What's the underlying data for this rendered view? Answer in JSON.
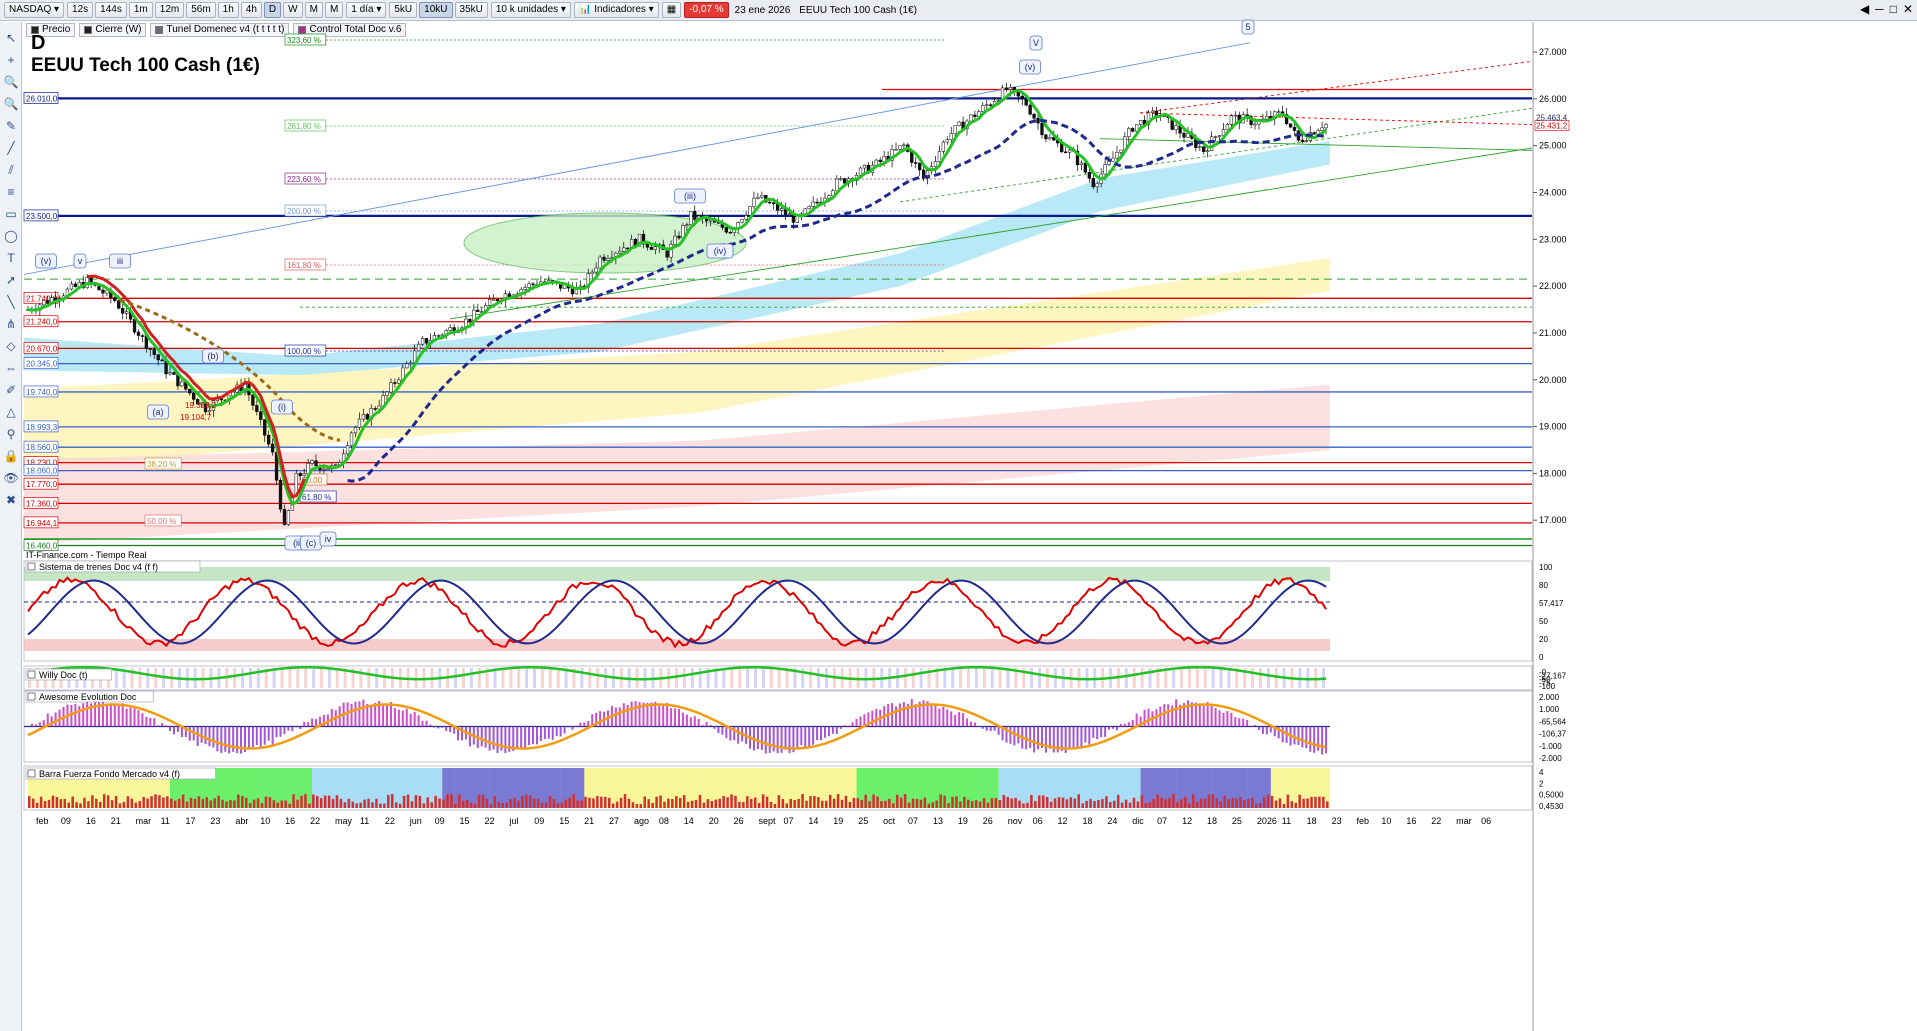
{
  "toolbar": {
    "symbol": "NASDAQ",
    "intervals": [
      "12s",
      "144s",
      "1m",
      "12m",
      "56m",
      "1h",
      "4h",
      "D",
      "W",
      "M",
      "M"
    ],
    "active_interval": "D",
    "period": "1 día",
    "units": [
      "5kU",
      "10kU",
      "35kU"
    ],
    "active_unit": "10kU",
    "unit_select": "10 k unidades",
    "indicators_label": "Indicadores",
    "change_badge": "-0,07 %",
    "date": "23 ene 2026",
    "instrument": "EEUU Tech 100 Cash (1€)"
  },
  "overlays": [
    "Precio",
    "Cierre (W)",
    "Tunel Domenec v4 (t t t t t)",
    "Control Total Doc v.6"
  ],
  "title": {
    "timeframe": "D",
    "name": "EEUU Tech 100 Cash (1€)"
  },
  "source": "IT-Finance.com - Tiempo Real",
  "price_axis": {
    "labels": [
      "27.000",
      "26.000",
      "25.000",
      "24.000",
      "23.000",
      "22.000",
      "21.000",
      "20.000",
      "19.000",
      "18.000",
      "17.000"
    ]
  },
  "price_current": [
    "25.431,2",
    "25.463,4"
  ],
  "level_labels": [
    {
      "text": "26.010,0",
      "color": "#0a1a8a"
    },
    {
      "text": "23.500,0",
      "color": "#0a1a8a"
    },
    {
      "text": "21.740,0",
      "color": "#d40000"
    },
    {
      "text": "21.240,0",
      "color": "#d40000"
    },
    {
      "text": "20.670,0",
      "color": "#d40000"
    },
    {
      "text": "20.345,0",
      "color": "#3a62c8"
    },
    {
      "text": "19.740,0",
      "color": "#3a62c8"
    },
    {
      "text": "18.993,3",
      "color": "#3a62c8"
    },
    {
      "text": "18.560,0",
      "color": "#3a62c8"
    },
    {
      "text": "18.230,0",
      "color": "#d40000"
    },
    {
      "text": "18.060,0",
      "color": "#3a62c8"
    },
    {
      "text": "17.770,0",
      "color": "#d40000"
    },
    {
      "text": "17.360,0",
      "color": "#d40000"
    },
    {
      "text": "16.944,1",
      "color": "#d40000"
    },
    {
      "text": "16.460,0",
      "color": "#1a7a1a"
    }
  ],
  "fib_labels": [
    {
      "text": "323,60 %",
      "color": "#1a8a1a"
    },
    {
      "text": "261,80 %",
      "color": "#5fbf5f"
    },
    {
      "text": "223,60 %",
      "color": "#8a2a8a"
    },
    {
      "text": "200,00 %",
      "color": "#7a9ad0"
    },
    {
      "text": "161,80 %",
      "color": "#e06060"
    },
    {
      "text": "100,00 %",
      "color": "#2030a0"
    },
    {
      "text": "50,00 %",
      "color": "#d07020"
    },
    {
      "text": "38,20 %",
      "color": "#c0a030"
    },
    {
      "text": "50,00 %",
      "color": "#e07070"
    },
    {
      "text": "61,80 %",
      "color": "#2030a0"
    },
    {
      "text": "50,00",
      "color": "#d07020"
    }
  ],
  "price_notes": [
    "19.328,2",
    "19.104,7"
  ],
  "waves": [
    "5",
    "V",
    "(v)",
    "(iii)",
    "(iv)",
    "(v)",
    "v",
    "iii",
    "(b)",
    "(a)",
    "(i)",
    "(ii)",
    "(c)",
    "iv"
  ],
  "time_axis": [
    "feb",
    "09",
    "16",
    "21",
    "mar",
    "11",
    "17",
    "23",
    "abr",
    "10",
    "16",
    "22",
    "may",
    "11",
    "22",
    "jun",
    "09",
    "15",
    "22",
    "jul",
    "09",
    "15",
    "21",
    "27",
    "ago",
    "08",
    "14",
    "20",
    "26",
    "sept",
    "07",
    "14",
    "19",
    "25",
    "oct",
    "07",
    "13",
    "19",
    "26",
    "nov",
    "06",
    "12",
    "18",
    "24",
    "dic",
    "07",
    "12",
    "18",
    "25",
    "2026",
    "11",
    "18",
    "23",
    "feb",
    "10",
    "16",
    "22",
    "mar",
    "06"
  ],
  "panels": [
    {
      "title": "Sistema de trenes Doc v4 (f f)",
      "axis": [
        "100",
        "80",
        "57,417",
        "50",
        "20",
        "0"
      ]
    },
    {
      "title": "Willy Doc (t)",
      "axis": [
        "-0",
        "-27,167",
        "-50",
        "-75",
        "-100"
      ]
    },
    {
      "title": "Awesome Evolution Doc",
      "axis": [
        "2.000",
        "1.000",
        "-65,564",
        "-106,37",
        "-1.000",
        "-2.000"
      ]
    },
    {
      "title": "Barra Fuerza Fondo Mercado v4 (f)",
      "axis": [
        "4",
        "2",
        "0,5000",
        "0,4530"
      ]
    }
  ],
  "colors": {
    "navy": "#0a1a8a",
    "red": "#e00000",
    "green": "#21c521",
    "blue_dash": "#1f2a8c",
    "panel_bg_green": "#9ed69e",
    "panel_bg_red": "#f2b5b5"
  }
}
